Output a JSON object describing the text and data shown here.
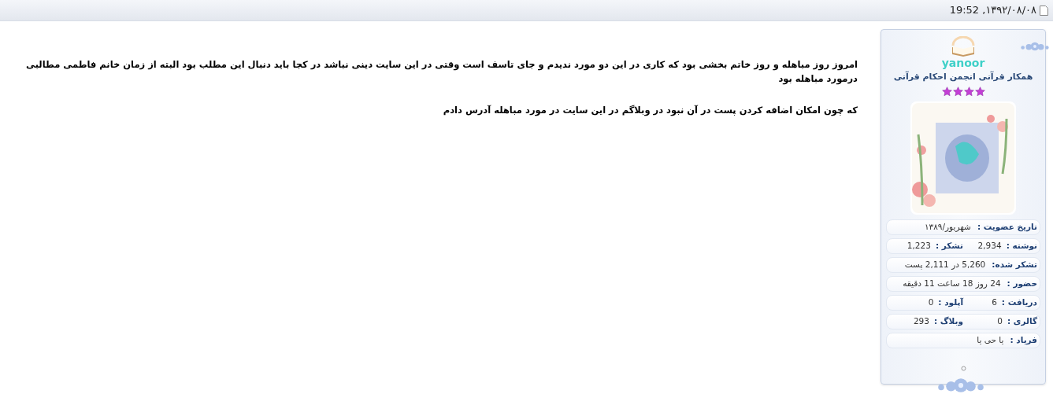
{
  "post_header": {
    "date": "۱۳۹۲/۰۸/۰۸, 19:52"
  },
  "post": {
    "paragraphs": [
      "امروز روز مباهله و روز خاتم بخشی بود که کاری در این دو مورد ندیدم و جای تاسف است وقتی در این سایت دینی نباشد در کجا باید دنبال این مطلب بود البته از زمان خانم فاطمی مطالبی درمورد مباهله بود",
      "که چون امکان اضافه کردن پست در آن نبود در وبلاگم در این سایت در مورد مباهله آدرس دادم"
    ]
  },
  "profile": {
    "username": "yanoor",
    "title": "همکار قرآنی انجمن احکام قرآنی",
    "stars": 4,
    "stats": [
      {
        "cells": [
          {
            "label": "تاریخ عضویت :",
            "value": "شهریور/۱۳۸۹"
          }
        ]
      },
      {
        "cells": [
          {
            "label": "نوشته :",
            "value": "2,934"
          },
          {
            "label": "تشکر :",
            "value": "1,223"
          }
        ]
      },
      {
        "cells": [
          {
            "label": "تشکر شده:",
            "value": "5,260 در 2,111 پست"
          }
        ]
      },
      {
        "cells": [
          {
            "label": "حضور :",
            "value": "24 روز 18 ساعت 11 دقیقه"
          }
        ]
      },
      {
        "cells": [
          {
            "label": "دریافت :",
            "value": "6"
          },
          {
            "label": "آپلود :",
            "value": "0"
          }
        ]
      },
      {
        "cells": [
          {
            "label": "گالری :",
            "value": "0"
          },
          {
            "label": "وبلاگ :",
            "value": "293"
          }
        ]
      },
      {
        "cells": [
          {
            "label": "فریاد :",
            "value": "یا حی یا"
          }
        ]
      }
    ]
  }
}
